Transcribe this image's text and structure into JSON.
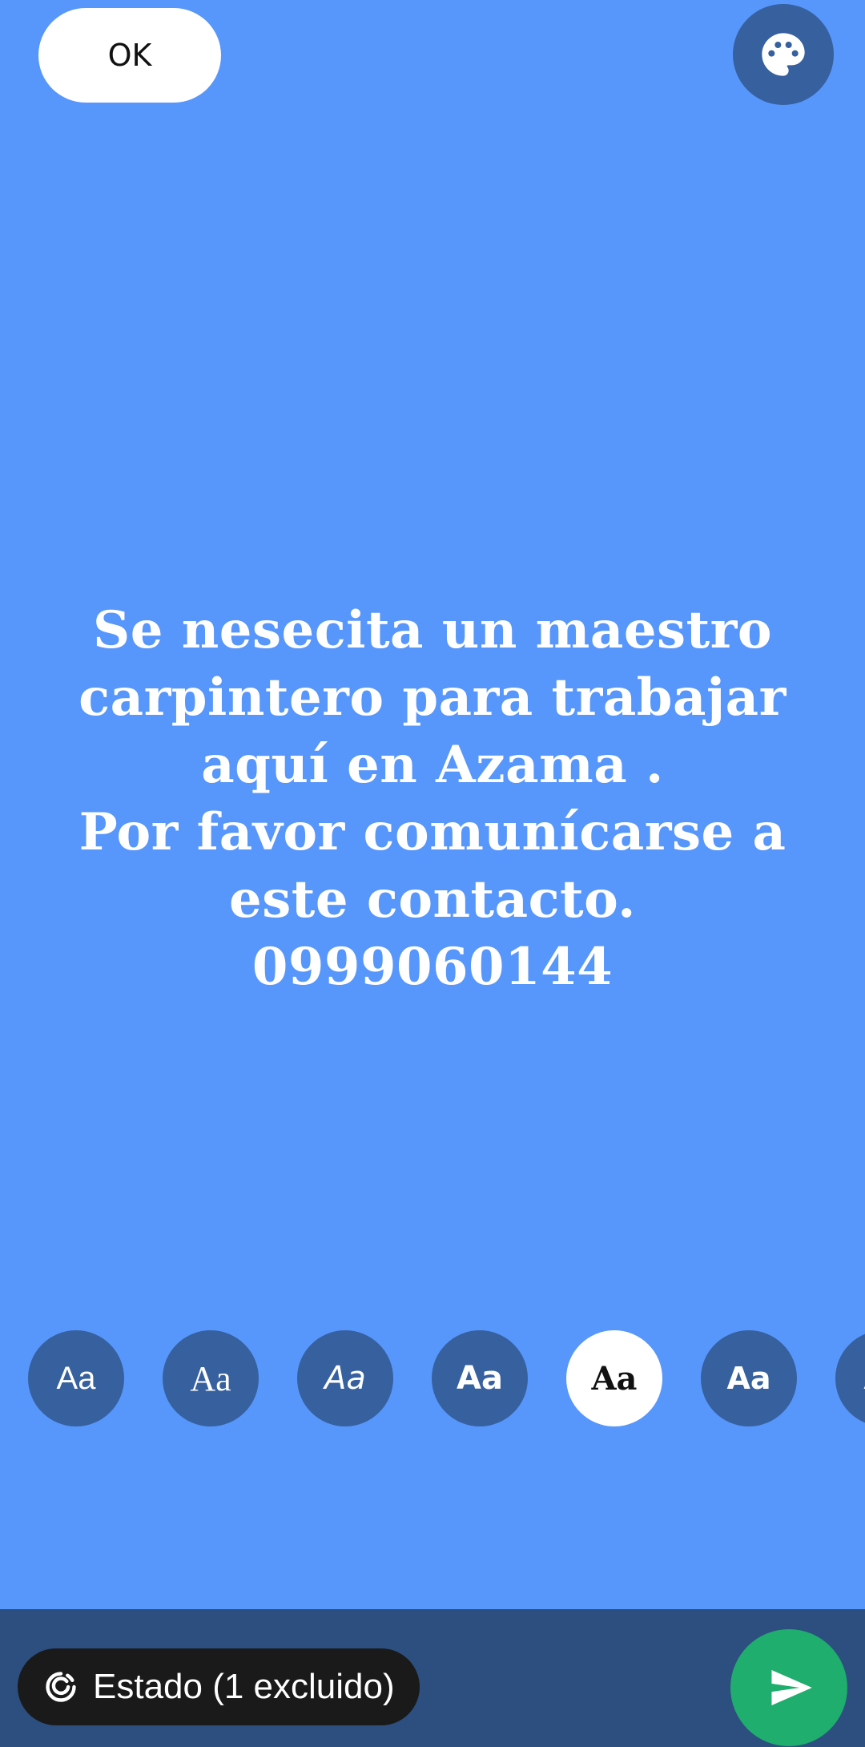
{
  "header": {
    "ok_label": "OK",
    "palette_icon": "palette-icon"
  },
  "status": {
    "text": "Se nesecita un maestro\ncarpintero para trabajar\naquí en Azama .\nPor favor comunícarse a\neste contacto.\n0999060144",
    "background_color": "#5796fb",
    "text_color": "#ffffff"
  },
  "font_picker": {
    "options": [
      {
        "label": "Aa",
        "selected": false
      },
      {
        "label": "Aa",
        "selected": false
      },
      {
        "label": "Aa",
        "selected": false
      },
      {
        "label": "Aa",
        "selected": false
      },
      {
        "label": "Aa",
        "selected": true
      },
      {
        "label": "Aa",
        "selected": false
      },
      {
        "label": "Aa",
        "selected": false
      }
    ]
  },
  "bottom_bar": {
    "audience_label": "Estado (1 excluido)",
    "audience_icon": "status-ring-icon",
    "send_icon": "send-icon",
    "send_color": "#1fae6d"
  }
}
